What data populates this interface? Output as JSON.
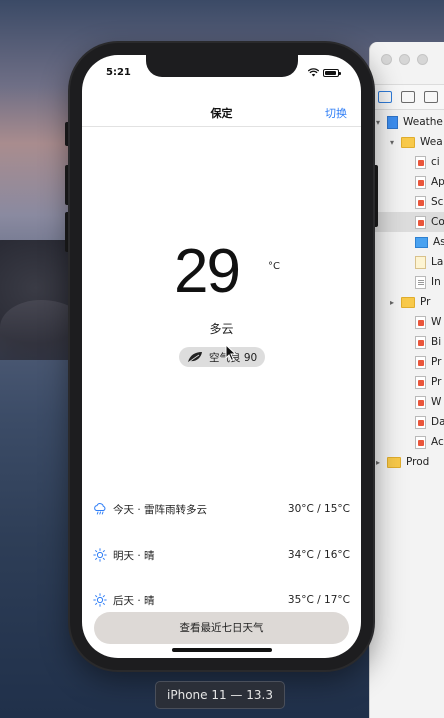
{
  "status_bar": {
    "time": "5:21"
  },
  "navbar": {
    "title": "保定",
    "right_action": "切换"
  },
  "current": {
    "temperature": "29",
    "unit": "°C",
    "condition": "多云",
    "air_quality": "空气良 90"
  },
  "forecast": [
    {
      "label": "今天 · 雷阵雨转多云",
      "range": "30°C  / 15°C",
      "icon": "cloud-rain-icon"
    },
    {
      "label": "明天 · 晴",
      "range": "34°C  / 16°C",
      "icon": "sun-icon"
    },
    {
      "label": "后天 · 晴",
      "range": "35°C  / 17°C",
      "icon": "sun-icon"
    }
  ],
  "week_button": "查看最近七日天气",
  "simulator_label": "iPhone 11 — 13.3",
  "xcode_tree": [
    {
      "label": "Weathe",
      "kind": "proj",
      "indent": 0,
      "tri": "▾"
    },
    {
      "label": "Wea",
      "kind": "fold",
      "indent": 1,
      "tri": "▾"
    },
    {
      "label": "ci",
      "kind": "swift",
      "indent": 2,
      "tri": ""
    },
    {
      "label": "Ap",
      "kind": "swift",
      "indent": 2,
      "tri": ""
    },
    {
      "label": "Sc",
      "kind": "swift",
      "indent": 2,
      "tri": ""
    },
    {
      "label": "Co",
      "kind": "swift",
      "indent": 2,
      "tri": "",
      "selected": true
    },
    {
      "label": "As",
      "kind": "blue",
      "indent": 2,
      "tri": ""
    },
    {
      "label": "La",
      "kind": "storyboard",
      "indent": 2,
      "tri": ""
    },
    {
      "label": "In",
      "kind": "plain",
      "indent": 2,
      "tri": ""
    },
    {
      "label": "Pr",
      "kind": "fold",
      "indent": 1,
      "tri": "▸"
    },
    {
      "label": "W",
      "kind": "swift",
      "indent": 2,
      "tri": ""
    },
    {
      "label": "Bi",
      "kind": "swift",
      "indent": 2,
      "tri": ""
    },
    {
      "label": "Pr",
      "kind": "swift",
      "indent": 2,
      "tri": ""
    },
    {
      "label": "Pr",
      "kind": "swift",
      "indent": 2,
      "tri": ""
    },
    {
      "label": "W",
      "kind": "swift",
      "indent": 2,
      "tri": ""
    },
    {
      "label": "Da",
      "kind": "swift",
      "indent": 2,
      "tri": ""
    },
    {
      "label": "Ac",
      "kind": "swift",
      "indent": 2,
      "tri": ""
    },
    {
      "label": "Prod",
      "kind": "fold",
      "indent": 0,
      "tri": "▸"
    }
  ]
}
